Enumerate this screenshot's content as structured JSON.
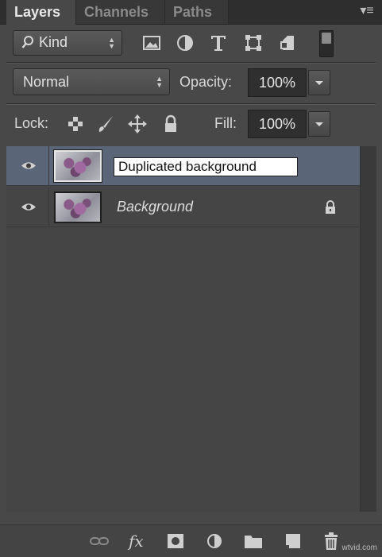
{
  "tabs": [
    {
      "label": "Layers"
    },
    {
      "label": "Channels"
    },
    {
      "label": "Paths"
    }
  ],
  "filter": {
    "kind_label": "Kind",
    "icons": [
      "image-filter-icon",
      "adjustment-filter-icon",
      "type-filter-icon",
      "shape-filter-icon",
      "smart-object-filter-icon",
      "filter-toggle-switch"
    ]
  },
  "blend": {
    "mode": "Normal",
    "opacity_label": "Opacity:",
    "opacity_value": "100%"
  },
  "lock": {
    "label": "Lock:",
    "fill_label": "Fill:",
    "fill_value": "100%"
  },
  "layers": [
    {
      "name": "Duplicated background",
      "editing": true,
      "selected": true
    },
    {
      "name": "Background",
      "editing": false,
      "selected": false,
      "locked": true
    }
  ],
  "footer": {
    "fx_label": "fx",
    "watermark": "wtvid.com"
  },
  "colors": {
    "panel_bg": "#484848",
    "selected_row": "#5a6578"
  }
}
